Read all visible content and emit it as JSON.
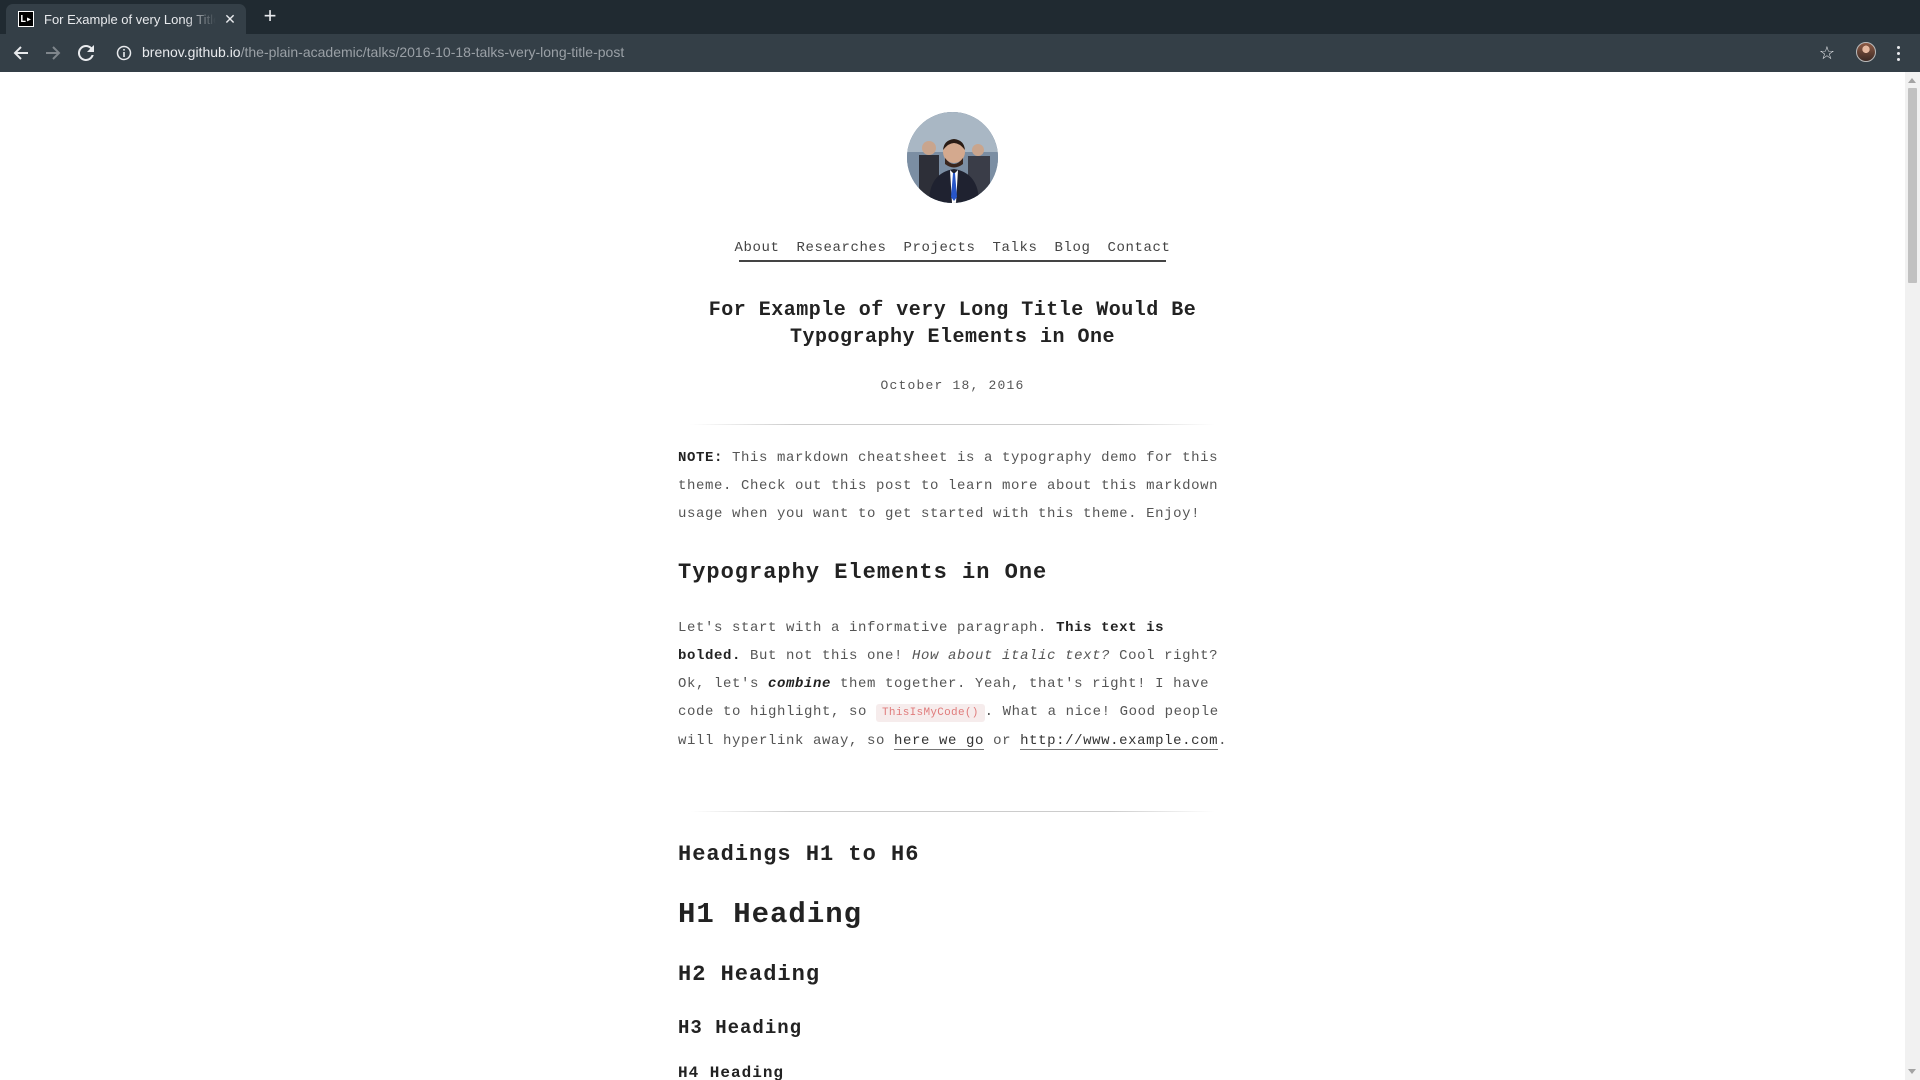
{
  "browser": {
    "tab_title": "For Example of very Long Title Would Be Typography Elements in One",
    "tab_favicon_text": "L▸",
    "url_host": "brenov.github.io",
    "url_path": "/the-plain-academic/talks/2016-10-18-talks-very-long-title-post"
  },
  "nav": {
    "items": [
      "About",
      "Researches",
      "Projects",
      "Talks",
      "Blog",
      "Contact"
    ]
  },
  "post": {
    "title_line1": "For Example of very Long Title Would Be",
    "title_line2": "Typography Elements in One",
    "date": "October 18, 2016",
    "note_label": "NOTE:",
    "note_text": " This markdown cheatsheet is a typography demo for this theme. Check out this post to learn more about this markdown usage when you want to get started with this theme. Enjoy!",
    "section1_heading": "Typography Elements in One",
    "p1_a": "Let's start with a informative paragraph. ",
    "p1_bold": "This text is bolded.",
    "p1_b": " But not this one! ",
    "p1_italic": "How about italic text?",
    "p1_c": " Cool right? Ok, let's ",
    "p1_bolditalic": "combine",
    "p1_d": " them together. Yeah, that's right! I have code to highlight, so ",
    "p1_code": "ThisIsMyCode()",
    "p1_e": ". What a nice! Good people will hyperlink away, so ",
    "p1_link1": "here we go",
    "p1_f": " or ",
    "p1_link2": "http://www.example.com",
    "p1_g": ".",
    "section2_heading": "Headings H1 to H6",
    "h1": "H1 Heading",
    "h2": "H2 Heading",
    "h3": "H3 Heading",
    "h4": "H4 Heading"
  }
}
